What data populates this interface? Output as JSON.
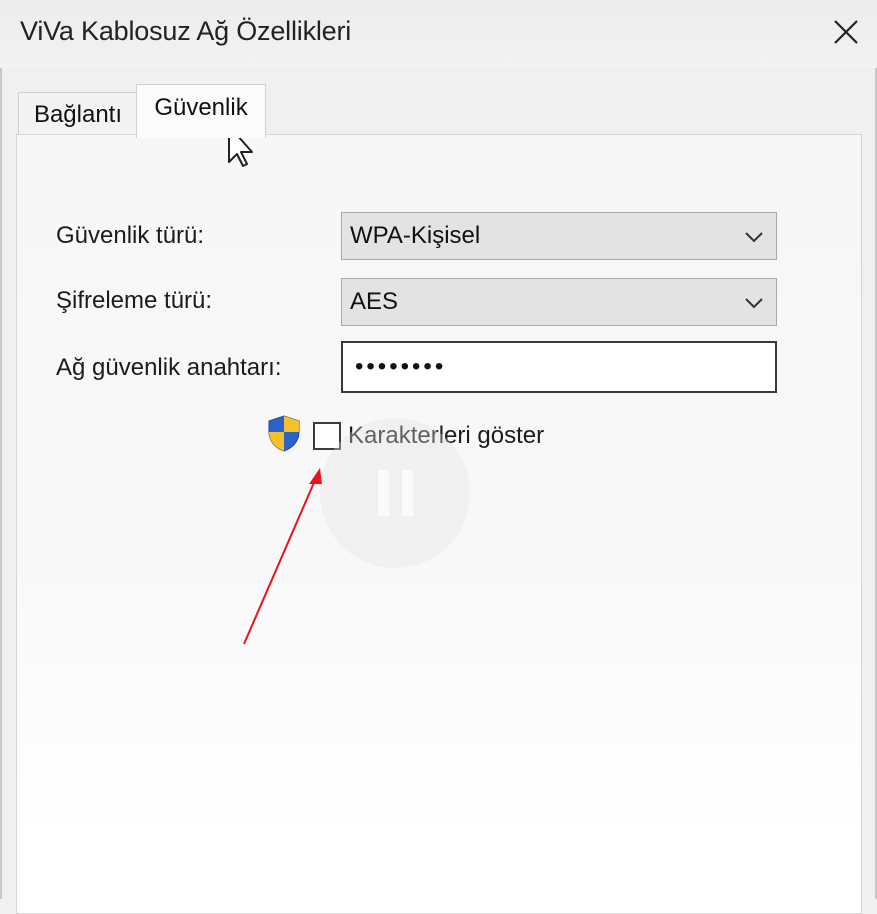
{
  "window": {
    "title": "ViVa Kablosuz Ağ Özellikleri",
    "close_icon": "close-icon"
  },
  "tabs": [
    {
      "label": "Bağlantı",
      "active": false
    },
    {
      "label": "Güvenlik",
      "active": true
    }
  ],
  "security": {
    "type_label": "Güvenlik türü:",
    "type_value": "WPA-Kişisel",
    "encryption_label": "Şifreleme türü:",
    "encryption_value": "AES",
    "key_label": "Ağ güvenlik anahtarı:",
    "key_value": "••••••••",
    "show_chars_label": "Karakterleri göster",
    "show_chars_checked": false
  },
  "overlay": {
    "annotation_icon": "red-arrow",
    "video_icon": "pause-icon",
    "annotation_color": "#e8141e",
    "shield_colors": [
      "#2b63c9",
      "#f4c228"
    ]
  }
}
